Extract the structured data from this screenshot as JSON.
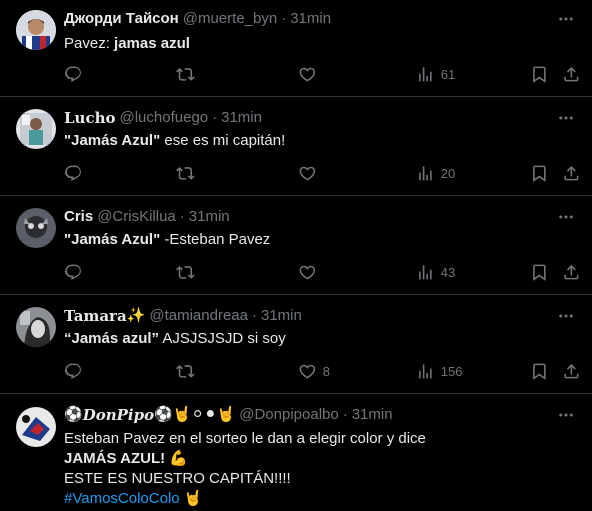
{
  "tweets": [
    {
      "name": "Джорди Тайсон",
      "handle": "@muerte_byn",
      "dot": "·",
      "time": "31min",
      "text_plain": "Pavez: ",
      "text_bold": "jamas azul",
      "views": "61",
      "replies": "",
      "retweets": "",
      "likes": ""
    },
    {
      "name": "Lucho",
      "handle": "@luchofuego",
      "dot": "·",
      "time": "31min",
      "text_bold": "\"Jamás Azul\"",
      "text_plain": " ese es mi capitán!",
      "views": "20"
    },
    {
      "name": "Cris",
      "handle": "@CrisKillua",
      "dot": "·",
      "time": "31min",
      "text_bold": "\"Jamás Azul\"",
      "text_plain": " -Esteban Pavez",
      "views": "43"
    },
    {
      "name": "Tamara",
      "name_emoji": "✨",
      "handle": "@tamiandreaa",
      "dot": "·",
      "time": "31min",
      "text_bold": "“Jamás azul”",
      "text_plain": " AJSJSJSJD si soy",
      "likes": "8",
      "views": "156"
    },
    {
      "name": "DonPipo",
      "name_prefix": "⚽",
      "name_suffix": "⚽🤘⚪⚫🤘",
      "handle": "@Donpipoalbo",
      "dot": "·",
      "time": "31min",
      "line1": "Esteban Pavez en  el sorteo le dan a elegir color y dice",
      "line2": "JAMÁS AZUL! 💪",
      "line3": "ESTE ES NUESTRO CAPITÁN!!!!",
      "hashtag": "#VamosColoColo",
      "hashtag_emoji": "🤘"
    }
  ],
  "colors": {
    "background": "#000000",
    "divider": "#2f3336",
    "text": "#e7e9ea",
    "muted": "#71767b",
    "link": "#1d9bf0"
  },
  "icons": [
    "more-icon",
    "reply-icon",
    "retweet-icon",
    "like-icon",
    "views-icon",
    "bookmark-icon",
    "share-icon"
  ]
}
